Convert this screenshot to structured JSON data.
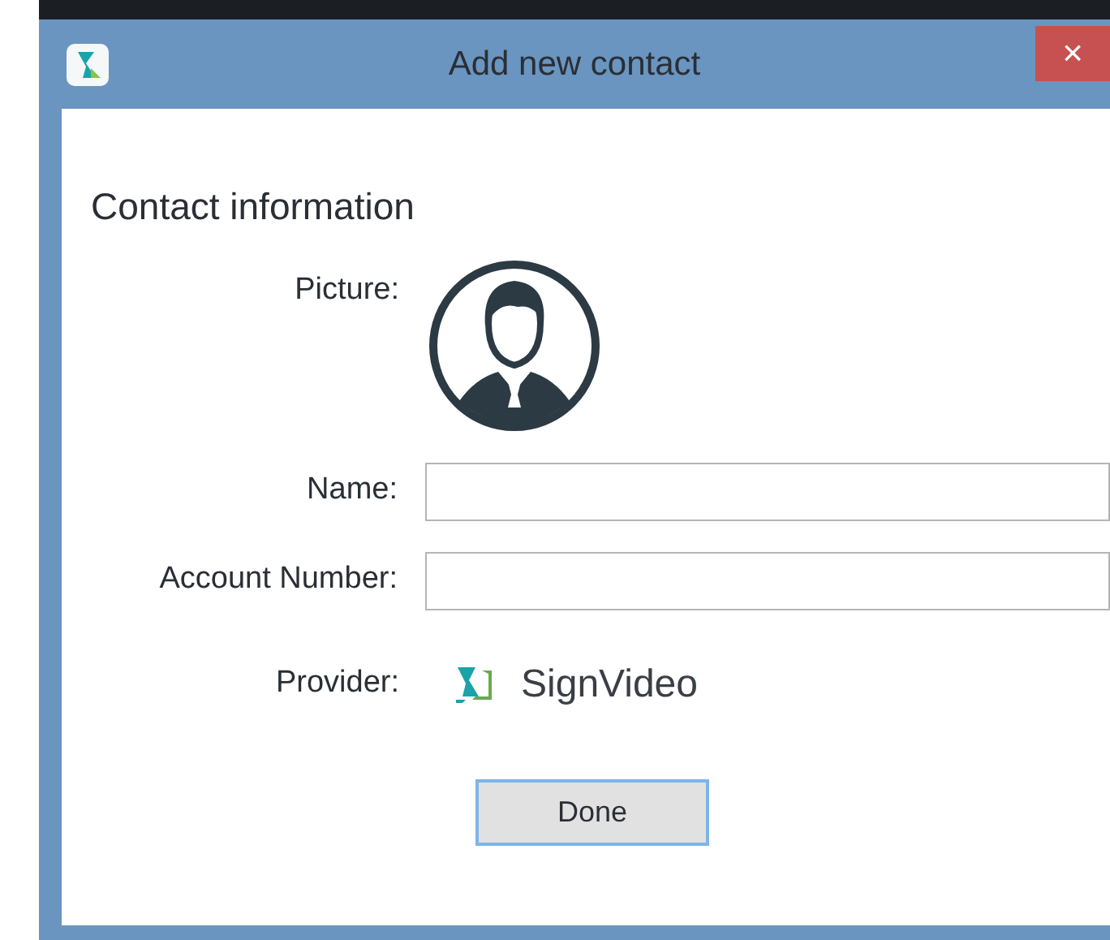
{
  "window": {
    "title": "Add new contact",
    "close": "×"
  },
  "section_title": "Contact information",
  "fields": [
    {
      "kind": "picture",
      "label": "Picture:"
    },
    {
      "kind": "input",
      "label": "Name:"
    },
    {
      "kind": "input",
      "label": "Account Number:"
    },
    {
      "kind": "provider",
      "label": "Provider:",
      "value": "SignVideo"
    }
  ],
  "buttons": [
    "Done"
  ]
}
